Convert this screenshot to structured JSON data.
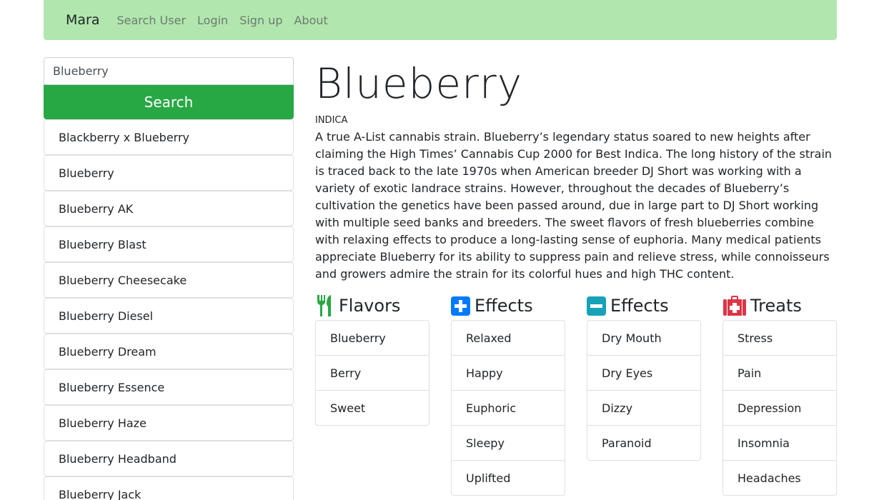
{
  "navbar": {
    "brand": "Mara",
    "links": [
      "Search User",
      "Login",
      "Sign up",
      "About"
    ]
  },
  "sidebar": {
    "search_value": "Blueberry",
    "search_button": "Search",
    "results": [
      "Blackberry x Blueberry",
      "Blueberry",
      "Blueberry AK",
      "Blueberry Blast",
      "Blueberry Cheesecake",
      "Blueberry Diesel",
      "Blueberry Dream",
      "Blueberry Essence",
      "Blueberry Haze",
      "Blueberry Headband",
      "Blueberry Jack"
    ]
  },
  "strain": {
    "name": "Blueberry",
    "type": "INDICA",
    "description": "A true A-List cannabis strain. Blueberry’s legendary status soared to new heights after claiming the High Times’ Cannabis Cup 2000 for Best Indica. The long history of the strain is traced back to the late 1970s when American breeder DJ Short was working with a variety of exotic landrace strains. However, throughout the decades of Blueberry’s cultivation the genetics have been passed around, due in large part to DJ Short working with multiple seed banks and breeders. The sweet flavors of fresh blueberries combine with relaxing effects to produce a long-lasting sense of euphoria. Many medical patients appreciate Blueberry for its ability to suppress pain and relieve stress, while connoisseurs and growers admire the strain for its colorful hues and high THC content."
  },
  "columns": [
    {
      "title": "Flavors",
      "icon": "utensils-icon",
      "color": "#28a745",
      "items": [
        "Blueberry",
        "Berry",
        "Sweet"
      ]
    },
    {
      "title": "Effects",
      "icon": "plus-square-icon",
      "color": "#007bff",
      "items": [
        "Relaxed",
        "Happy",
        "Euphoric",
        "Sleepy",
        "Uplifted"
      ]
    },
    {
      "title": "Effects",
      "icon": "minus-square-icon",
      "color": "#17a2b8",
      "items": [
        "Dry Mouth",
        "Dry Eyes",
        "Dizzy",
        "Paranoid"
      ]
    },
    {
      "title": "Treats",
      "icon": "first-aid-kit-icon",
      "color": "#dc3545",
      "items": [
        "Stress",
        "Pain",
        "Depression",
        "Insomnia",
        "Headaches"
      ]
    }
  ]
}
